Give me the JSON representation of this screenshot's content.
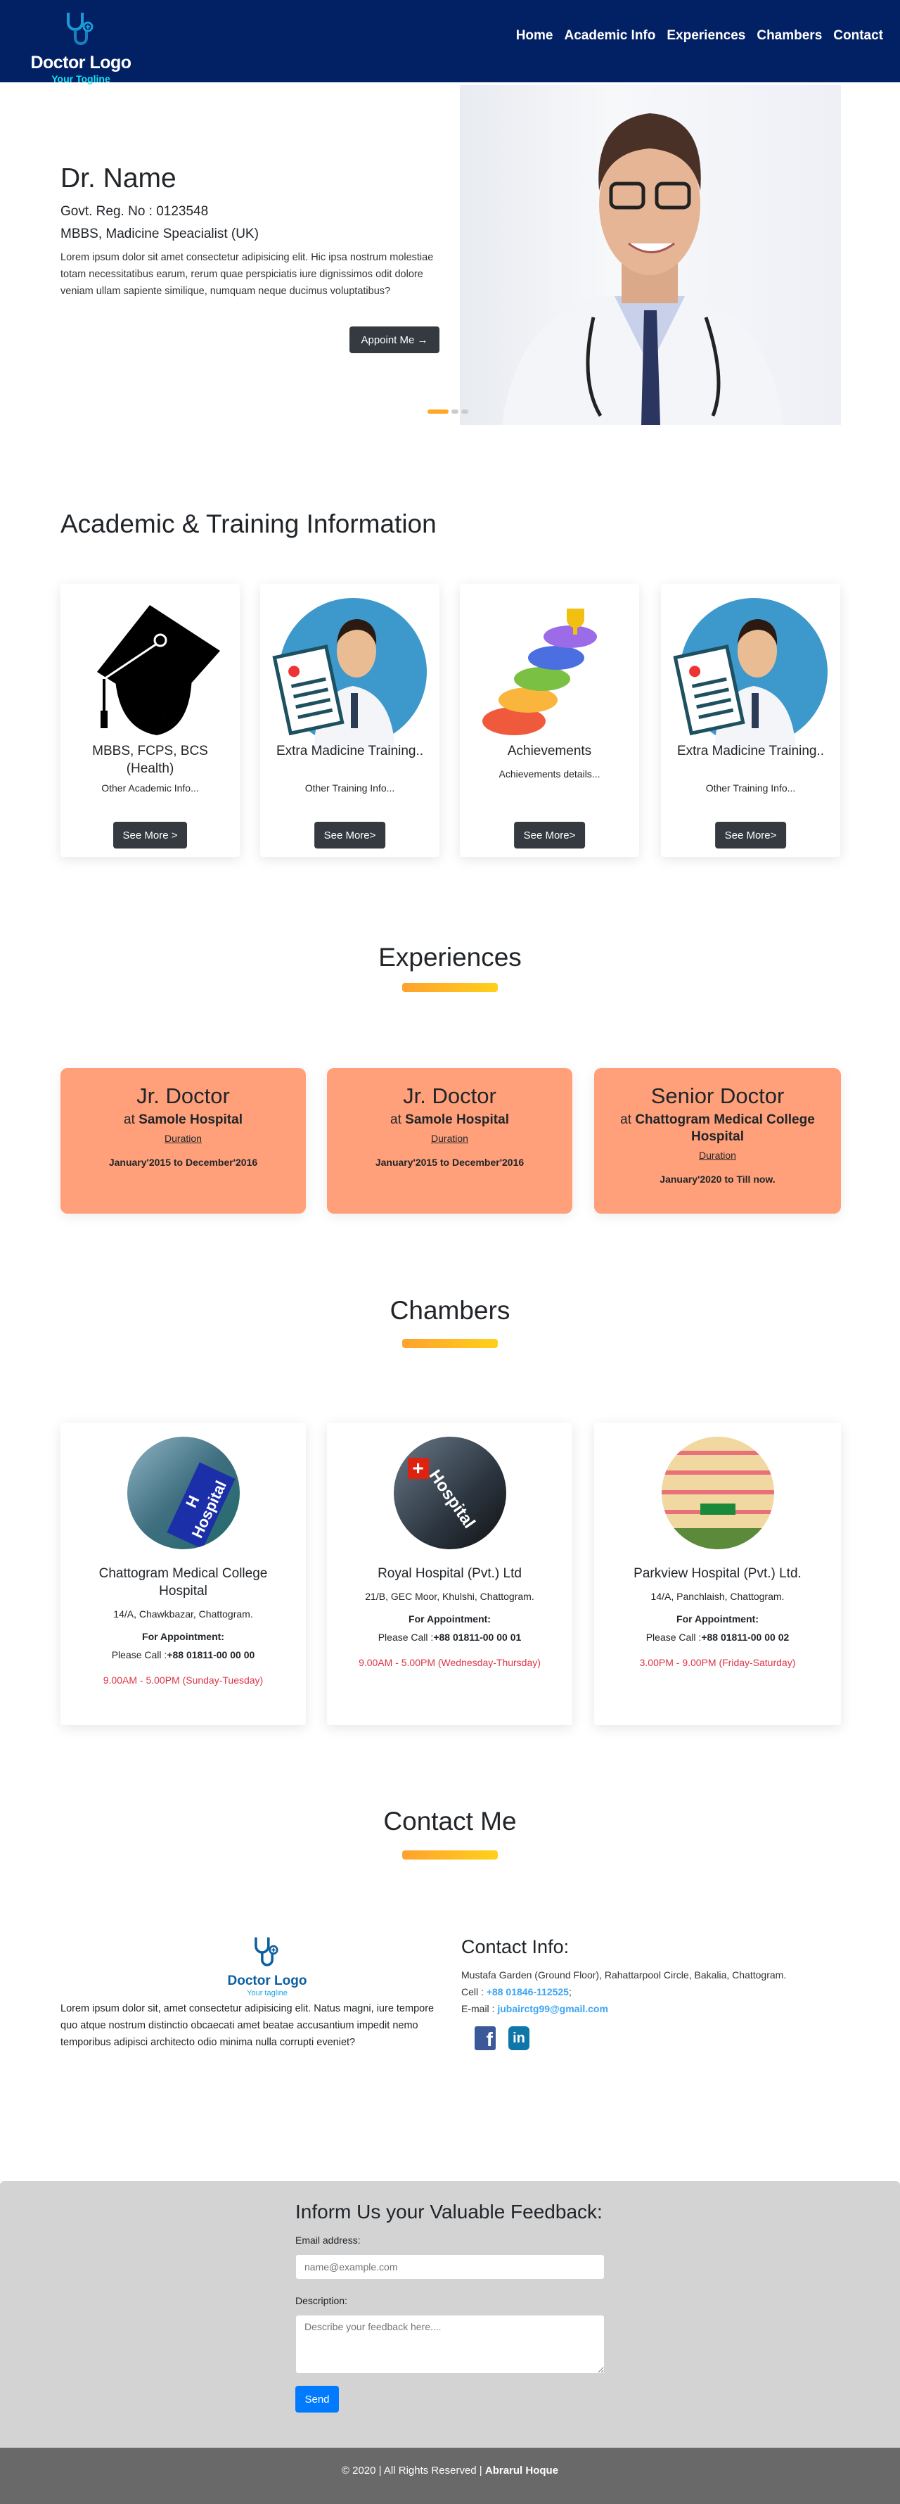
{
  "nav": {
    "logo_title": "Doctor Logo",
    "logo_tagline": "Your Togline",
    "items": [
      "Home",
      "Academic Info",
      "Experiences",
      "Chambers",
      "Contact"
    ]
  },
  "hero": {
    "name": "Dr. Name",
    "reg": "Govt. Reg. No : 0123548",
    "degree": "MBBS, Madicine Speacialist (UK)",
    "text": "Lorem ipsum dolor sit amet consectetur adipisicing elit. Hic ipsa nostrum molestiae totam necessitatibus earum, rerum quae perspiciatis iure dignissimos odit dolore veniam ullam sapiente similique, numquam neque ducimus voluptatibus?",
    "button": "Appoint Me →",
    "slides": 3,
    "active_slide": 1
  },
  "academic": {
    "title": "Academic & Training Information",
    "cards": [
      {
        "title": "MBBS, FCPS, BCS (Health)",
        "sub": "Other Academic Info...",
        "button": "See More >",
        "icon": "graduation-cap"
      },
      {
        "title": "Extra Madicine Training..",
        "sub": "Other Training Info...",
        "button": "See More>",
        "icon": "doctor-clipboard"
      },
      {
        "title": "Achievements",
        "sub": "Achievements details...",
        "button": "See More>",
        "icon": "steps-trophy"
      },
      {
        "title": "Extra Madicine Training..",
        "sub": "Other Training Info...",
        "button": "See More>",
        "icon": "doctor-clipboard"
      }
    ]
  },
  "experiences": {
    "title": "Experiences",
    "cards": [
      {
        "role": "Jr. Doctor",
        "at": "at",
        "place": "Samole Hospital",
        "label": "Duration",
        "dates": "January'2015 to December'2016"
      },
      {
        "role": "Jr. Doctor",
        "at": "at",
        "place": "Samole Hospital",
        "label": "Duration",
        "dates": "January'2015 to December'2016"
      },
      {
        "role": "Senior Doctor",
        "at": "at",
        "place": "Chattogram Medical College Hospital",
        "label": "Duration",
        "dates": "January'2020 to Till now."
      }
    ]
  },
  "chambers": {
    "title": "Chambers",
    "cards": [
      {
        "name": "Chattogram Medical College Hospital",
        "address": "14/A, Chawkbazar, Chattogram.",
        "appt": "For Appointment:",
        "call": "Please Call :",
        "phone": "+88 01811-00 00 00",
        "time": "9.00AM - 5.00PM (Sunday-Tuesday)"
      },
      {
        "name": "Royal Hospital (Pvt.) Ltd",
        "address": "21/B, GEC Moor, Khulshi, Chattogram.",
        "appt": "For Appointment:",
        "call": "Please Call :",
        "phone": "+88 01811-00 00 01",
        "time": "9.00AM - 5.00PM (Wednesday-Thursday)"
      },
      {
        "name": "Parkview Hospital (Pvt.) Ltd.",
        "address": "14/A, Panchlaish, Chattogram.",
        "appt": "For Appointment:",
        "call": "Please Call :",
        "phone": "+88 01811-00 00 02",
        "time": "3.00PM - 9.00PM (Friday-Saturday)"
      }
    ]
  },
  "contact": {
    "title": "Contact Me",
    "logo_title": "Doctor Logo",
    "logo_tagline": "Your tagline",
    "text": "Lorem ipsum dolor sit, amet consectetur adipisicing elit. Natus magni, iure tempore quo atque nostrum distinctio obcaecati amet beatae accusantium impedit nemo temporibus adipisci architecto odio minima nulla corrupti eveniet?",
    "info_title": "Contact Info:",
    "address": "Mustafa Garden (Ground Floor), Rahattarpool Circle, Bakalia, Chattogram.",
    "cell_label": "Cell : ",
    "cell": "+88 01846-112525",
    "cell_end": ";",
    "email_label": "E-mail : ",
    "email": "jubairctg99@gmail.com"
  },
  "feedback": {
    "title": "Inform Us your Valuable Feedback:",
    "email_label": "Email address:",
    "email_placeholder": "name@example.com",
    "desc_label": "Description:",
    "desc_placeholder": "Describe your feedback here....",
    "button": "Send"
  },
  "footer": {
    "text": "© 2020 | All Rights Reserved | ",
    "author": "Abrarul Hoque"
  },
  "colors": {
    "nav": "#022064",
    "exp_card": "#ffa07a",
    "accent_from": "#ffa12e",
    "accent_to": "#ffd11a",
    "feedback_bg": "#d3d3d3",
    "footer_bg": "#696969",
    "time": "#dc3545",
    "link": "#3ba4f5",
    "send": "#007bff"
  }
}
